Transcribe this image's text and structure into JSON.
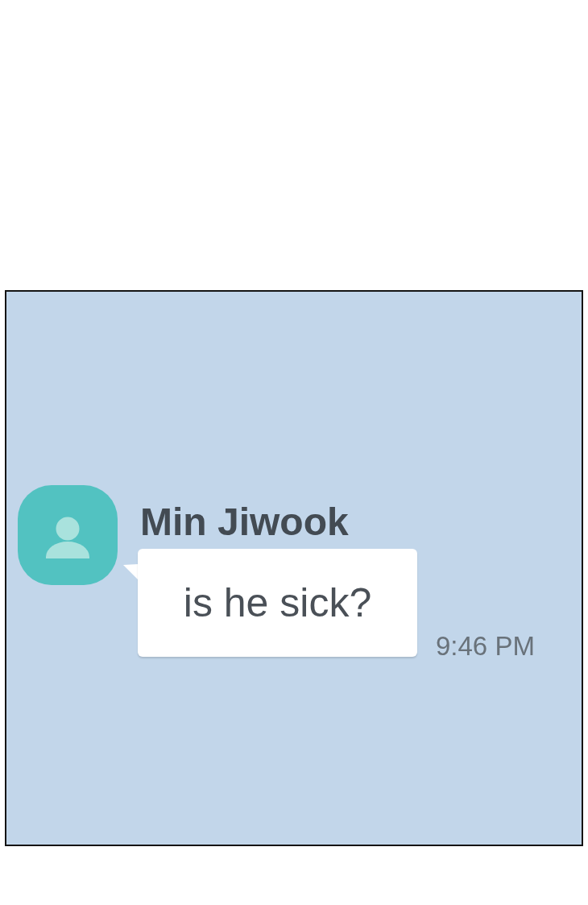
{
  "chat": {
    "messages": [
      {
        "sender": "Min Jiwook",
        "text": "is he sick?",
        "time": "9:46 PM"
      }
    ]
  }
}
